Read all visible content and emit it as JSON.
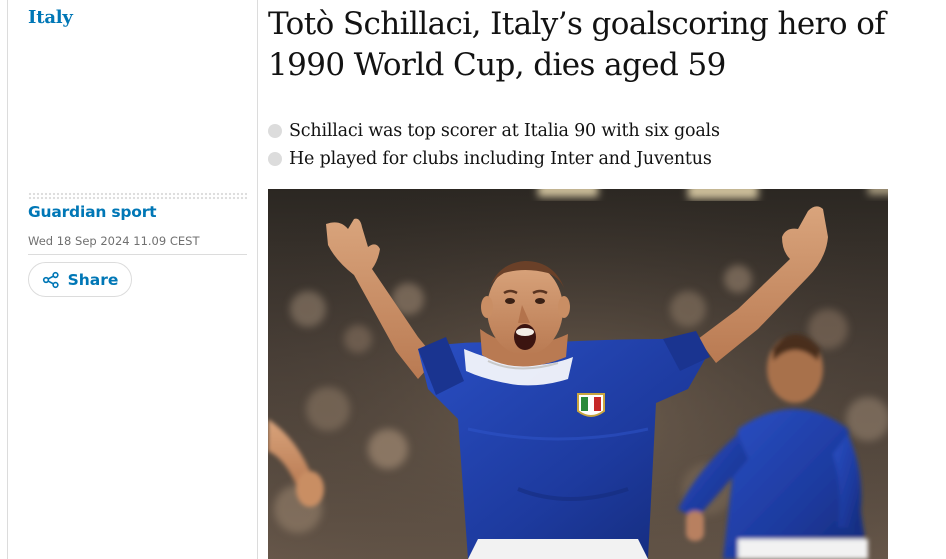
{
  "section": {
    "label": "Italy"
  },
  "headline": "Totò Schillaci, Italy’s goalscoring hero of 1990 World Cup, dies aged 59",
  "standfirst": [
    "Schillaci was top scorer at Italia 90 with six goals",
    "He played for clubs including Inter and Juventus"
  ],
  "byline": "Guardian sport",
  "dateline": "Wed 18 Sep 2024 11.09 CEST",
  "share": {
    "label": "Share",
    "icon": "share-icon"
  },
  "colors": {
    "accent": "#0077b6",
    "text": "#121212",
    "muted": "#707070",
    "rule": "#dcdcdc",
    "kit_blue": "#1d3a9e"
  }
}
